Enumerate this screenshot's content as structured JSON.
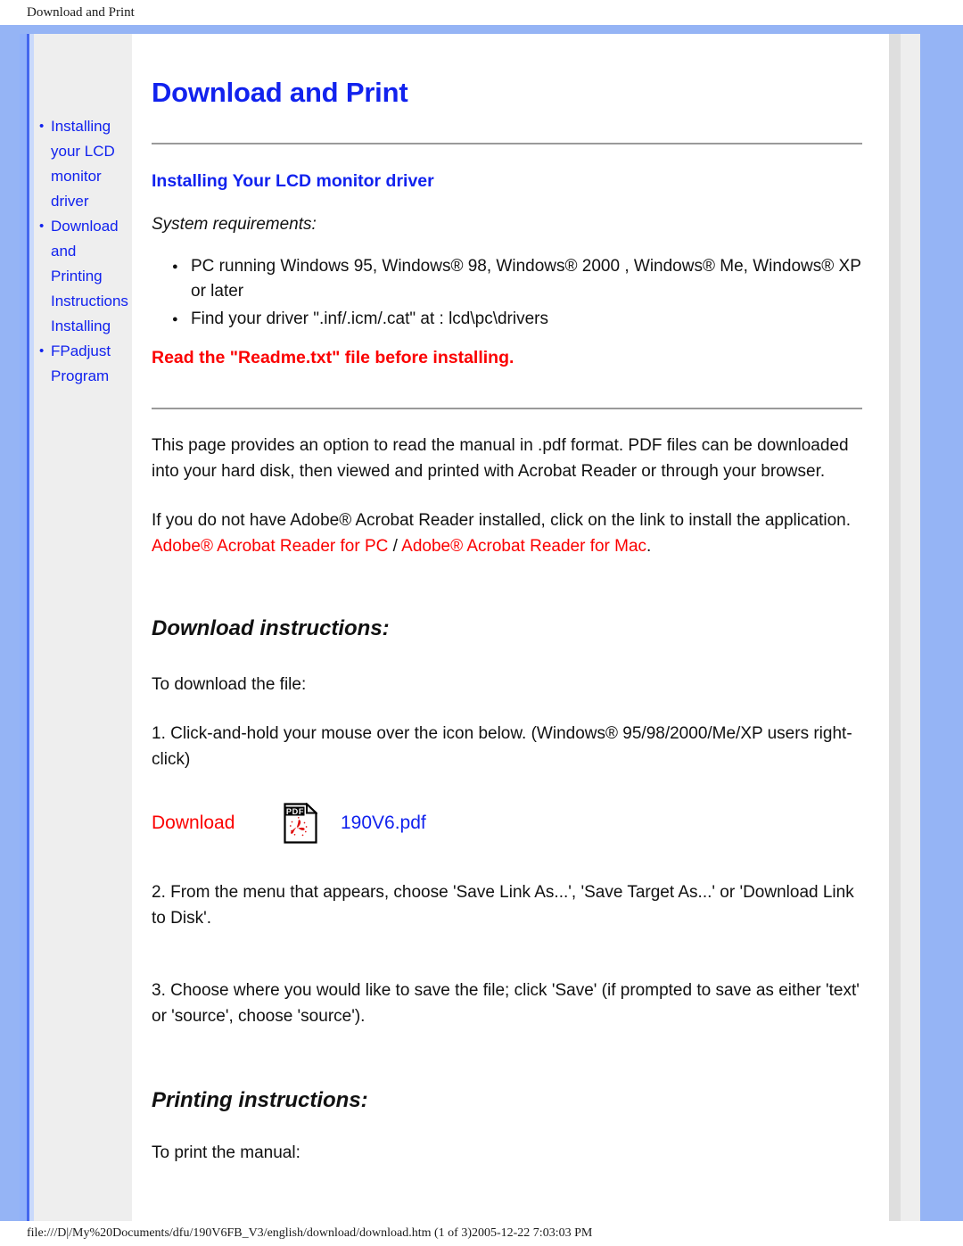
{
  "window": {
    "document_title": "Download and Print",
    "status_footer": "file:///D|/My%20Documents/dfu/190V6FB_V3/english/download/download.htm (1 of 3)2005-12-22 7:03:03 PM"
  },
  "colors": {
    "link_blue": "#1122ee",
    "link_red": "#fb0000",
    "frame_blue": "#95b4f5",
    "sidebar_gray": "#eeeeee",
    "rule_gray": "#9a9a9a"
  },
  "sidebar": {
    "items": [
      {
        "label": "Installing your LCD monitor driver"
      },
      {
        "label": "Download and Printing Instructions Installing"
      },
      {
        "label": "FPadjust Program"
      }
    ]
  },
  "main": {
    "title": "Download and Print",
    "section": {
      "heading": "Installing Your LCD monitor driver",
      "system_requirements_label": "System requirements:",
      "requirements": [
        "PC running Windows 95, Windows® 98, Windows® 2000 , Windows® Me, Windows® XP or later",
        "Find your driver \".inf/.icm/.cat\" at : lcd\\pc\\drivers"
      ],
      "warning": "Read the \"Readme.txt\" file before installing."
    },
    "paragraphs": {
      "intro": "This page provides an option to read the manual in .pdf format. PDF files can be downloaded into your hard disk, then viewed and printed with Acrobat Reader or through your browser.",
      "acrobat_notice": "If you do not have Adobe® Acrobat Reader installed, click on the link to install the application.",
      "acrobat_link_pc": "Adobe® Acrobat Reader for PC",
      "acrobat_link_separator": " / ",
      "acrobat_link_mac": "Adobe® Acrobat Reader for Mac",
      "acrobat_link_period": "."
    },
    "download": {
      "heading": "Download instructions:",
      "lead": "To download the file:",
      "steps": [
        "1. Click-and-hold your mouse over the icon below. (Windows® 95/98/2000/Me/XP users right-click)",
        "2. From the menu that appears, choose 'Save Link As...', 'Save Target As...' or 'Download Link to Disk'.",
        "3. Choose where you would like to save the file; click 'Save' (if prompted to save as either 'text' or 'source', choose 'source')."
      ],
      "row": {
        "label": "Download",
        "icon_name": "pdf-file-icon",
        "icon_badge_text": "PDF",
        "file_name": "190V6.pdf"
      }
    },
    "printing": {
      "heading": "Printing instructions:",
      "lead": "To print the manual:"
    }
  }
}
